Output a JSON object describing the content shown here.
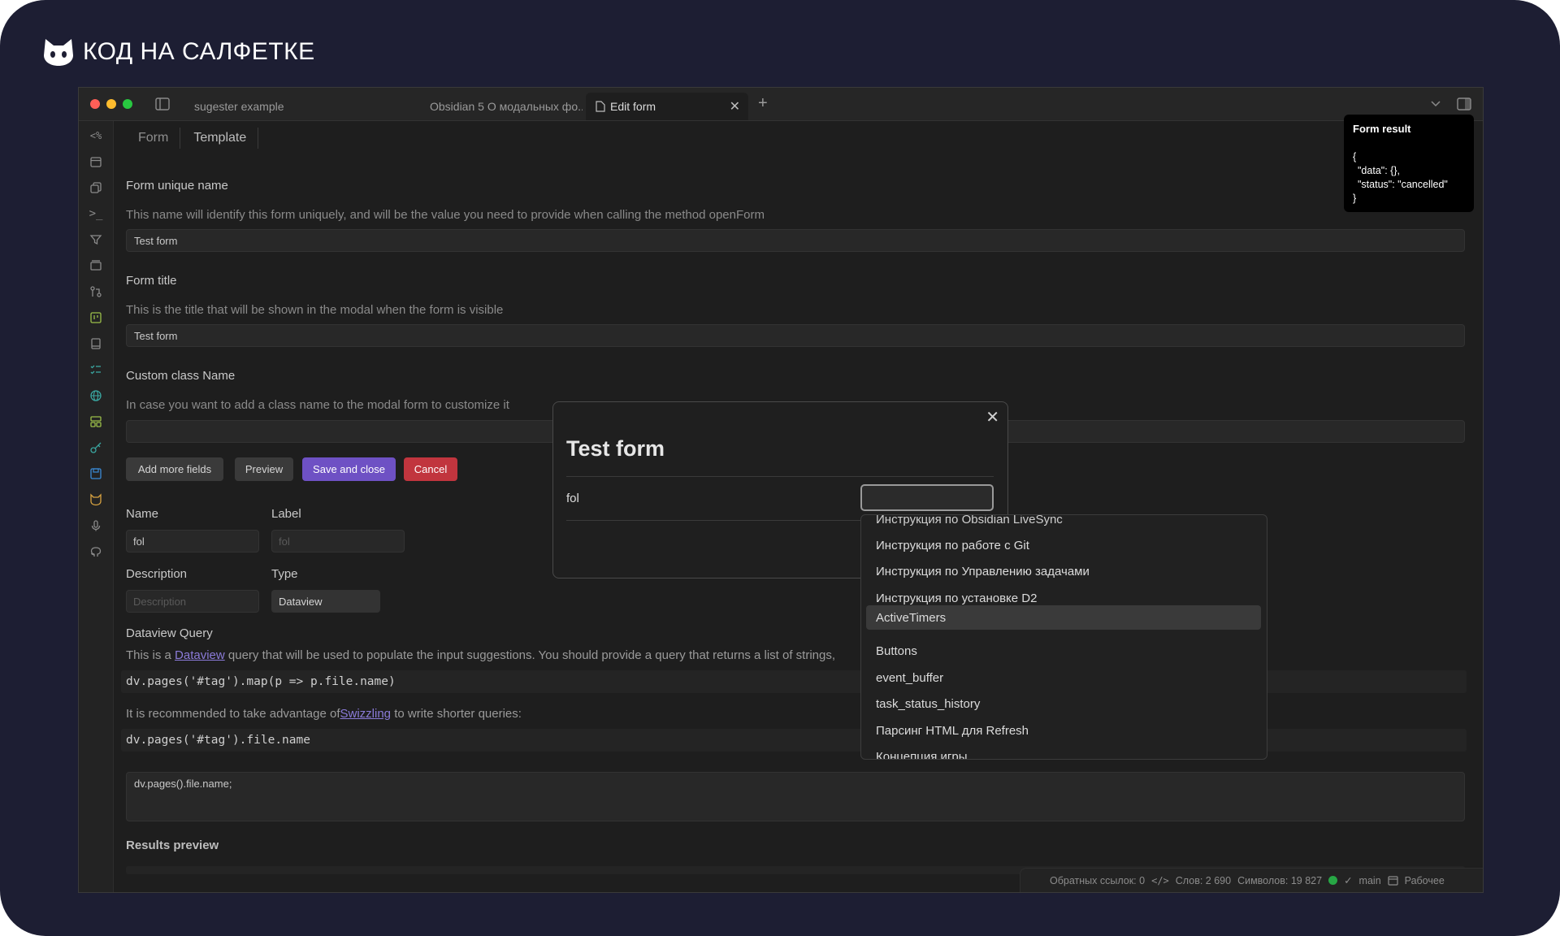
{
  "brand": {
    "name": "КОД НА САЛФЕТКЕ",
    "logo": "cat-face-icon"
  },
  "window": {
    "tabs": [
      {
        "label": "sugester example"
      },
      {
        "label": "Obsidian 5 О модальных фо..."
      },
      {
        "label": "Edit form",
        "active": true
      }
    ],
    "new_tab_symbol": "+"
  },
  "sidebar_icons": [
    "code-icon",
    "calendar-icon",
    "copy-icon",
    "terminal-icon",
    "filter-icon",
    "layers-icon",
    "git-compare-icon",
    "kanban-icon",
    "book-icon",
    "list-checks-icon",
    "globe-icon",
    "layout-icon",
    "key-icon",
    "save-icon",
    "cat-icon",
    "mic-icon",
    "github-icon"
  ],
  "view_tabs": [
    {
      "label": "Form"
    },
    {
      "label": "Template",
      "active": true
    }
  ],
  "fields": {
    "unique_name": {
      "label": "Form unique name",
      "desc": "This name will identify this form uniquely, and will be the value you need to provide when calling the method openForm",
      "value": "Test form"
    },
    "title": {
      "label": "Form title",
      "desc": "This is the title that will be shown in the modal when the form is visible",
      "value": "Test form"
    },
    "class_name": {
      "label": "Custom class Name",
      "desc": "In case you want to add a class name to the modal form to customize it",
      "value": ""
    }
  },
  "buttons": {
    "add_more": "Add more fields",
    "preview": "Preview",
    "save_close": "Save and close",
    "cancel": "Cancel"
  },
  "field_editor": {
    "name_label": "Name",
    "name_value": "fol",
    "label_label": "Label",
    "label_placeholder": "fol",
    "desc_label": "Description",
    "desc_placeholder": "Description",
    "type_label": "Type",
    "type_value": "Dataview"
  },
  "dataview": {
    "heading": "Dataview Query",
    "desc_prefix": "This is a ",
    "desc_link": "Dataview",
    "desc_suffix": " query that will be used to populate the input suggestions. You should provide a query that returns a list of strings,",
    "example1": "dv.pages('#tag').map(p => p.file.name)",
    "swizzle_prefix": "It is recommended to take advantage of",
    "swizzle_link": "Swizzling",
    "swizzle_suffix": " to write shorter queries:",
    "example2": "dv.pages('#tag').file.name",
    "query_value": "dv.pages().file.name;"
  },
  "results_preview": {
    "label": "Results preview"
  },
  "status_bar": {
    "backlinks": "Обратных ссылок: 0",
    "words": "Слов: 2 690",
    "chars": "Символов: 19 827",
    "branch": "main",
    "workspace": "Рабочее"
  },
  "modal": {
    "title": "Test form",
    "field_label": "fol",
    "input_value": ""
  },
  "suggestions": {
    "partial_top": "Инструкция по Obsidian LiveSync",
    "items": [
      "Инструкция по работе с Git",
      "Инструкция по Управлению задачами",
      "Инструкция по установке D2",
      "ActiveTimers",
      "Buttons",
      "event_buffer",
      "task_status_history",
      "Парсинг HTML для Refresh",
      "Концепция игры"
    ],
    "highlighted_index": 3
  },
  "toast": {
    "title": "Form result",
    "line1": "{",
    "line2": "\"data\": {},",
    "line3": "\"status\": \"cancelled\"",
    "line4": "}"
  },
  "colors": {
    "accent": "#6e51c4",
    "danger": "#c1353e",
    "background": "#1d1e33"
  }
}
